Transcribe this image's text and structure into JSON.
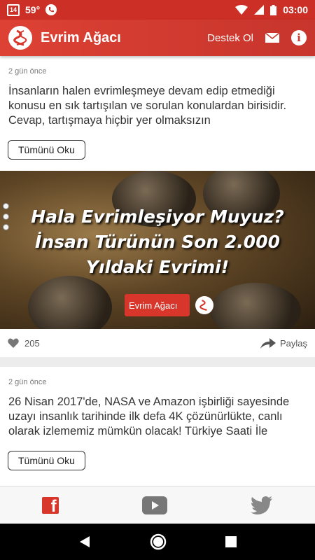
{
  "status_bar": {
    "notification_badge": "14",
    "temperature": "59°",
    "time": "03:00"
  },
  "app_bar": {
    "title": "Evrim Ağacı",
    "support_label": "Destek Ol",
    "icons": [
      "logo-icon",
      "mail-icon",
      "info-icon"
    ]
  },
  "feed": {
    "posts": [
      {
        "date": "2 gün önce",
        "excerpt": "İnsanların halen evrimleşmeye devam edip etmediği konusu en sık tartışılan ve sorulan konulardan birisidir. Cevap, tartışmaya hiçbir yer olmaksızın",
        "read_more": "Tümünü Oku",
        "image": {
          "headline": [
            "Hala Evrimleşiyor Muyuz?",
            "İnsan Türünün Son 2.000",
            "Yıldaki Evrimi!"
          ],
          "badge": "Evrim Ağacı"
        },
        "likes": "205",
        "share_label": "Paylaş"
      },
      {
        "date": "2 gün önce",
        "excerpt": "26 Nisan 2017'de, NASA ve Amazon işbirliği sayesinde uzayı insanlık tarihinde ilk defa 4K çözünürlükte, canlı olarak izlememiz mümkün olacak! Türkiye Saati İle",
        "read_more": "Tümünü Oku"
      }
    ]
  },
  "social_bar": {
    "icons": [
      "facebook-icon",
      "youtube-icon",
      "twitter-icon"
    ]
  },
  "nav_bar": {
    "icons": [
      "back-icon",
      "home-icon",
      "recents-icon"
    ]
  },
  "colors": {
    "brand_red": "#d8362b",
    "status_bar": "#cc2f26"
  }
}
